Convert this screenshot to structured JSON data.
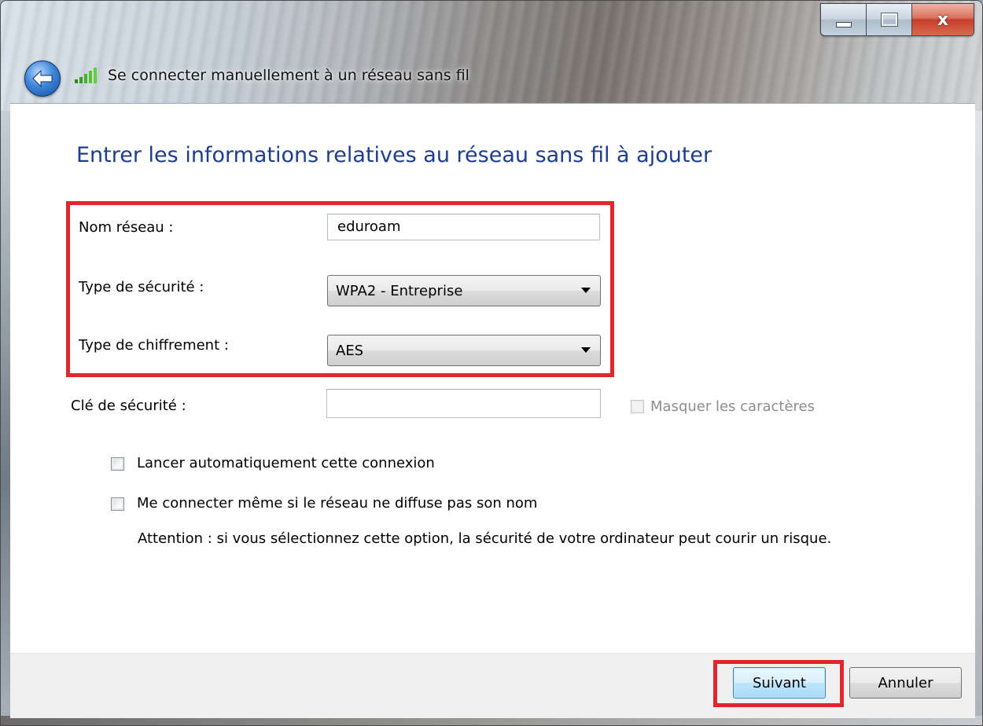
{
  "window": {
    "title": "Se connecter manuellement à un réseau sans fil",
    "close_glyph": "x",
    "icons": {
      "back": "back-arrow-icon",
      "network": "wireless-signal-icon"
    }
  },
  "content": {
    "heading": "Entrer les informations relatives au réseau sans fil à ajouter",
    "network_name": {
      "label": "Nom réseau :",
      "value": "eduroam"
    },
    "security_type": {
      "label": "Type de sécurité :",
      "value": "WPA2 - Entreprise"
    },
    "encryption_type": {
      "label": "Type de chiffrement :",
      "value": "AES"
    },
    "security_key": {
      "label": "Clé de sécurité :",
      "value": ""
    },
    "hide_characters": {
      "label": "Masquer les caractères",
      "checked": false,
      "enabled": false
    },
    "auto_start": {
      "label": "Lancer automatiquement cette connexion",
      "checked": false
    },
    "connect_hidden": {
      "label": "Me connecter même si le réseau ne diffuse pas son nom",
      "checked": false
    },
    "warning": "Attention : si vous sélectionnez cette option, la sécurité de votre ordinateur peut courir un risque."
  },
  "footer": {
    "next_label": "Suivant",
    "cancel_label": "Annuler"
  },
  "colors": {
    "heading": "#1e3d8f",
    "highlight": "#e0262f",
    "default_button_border": "#3c7fb1"
  }
}
